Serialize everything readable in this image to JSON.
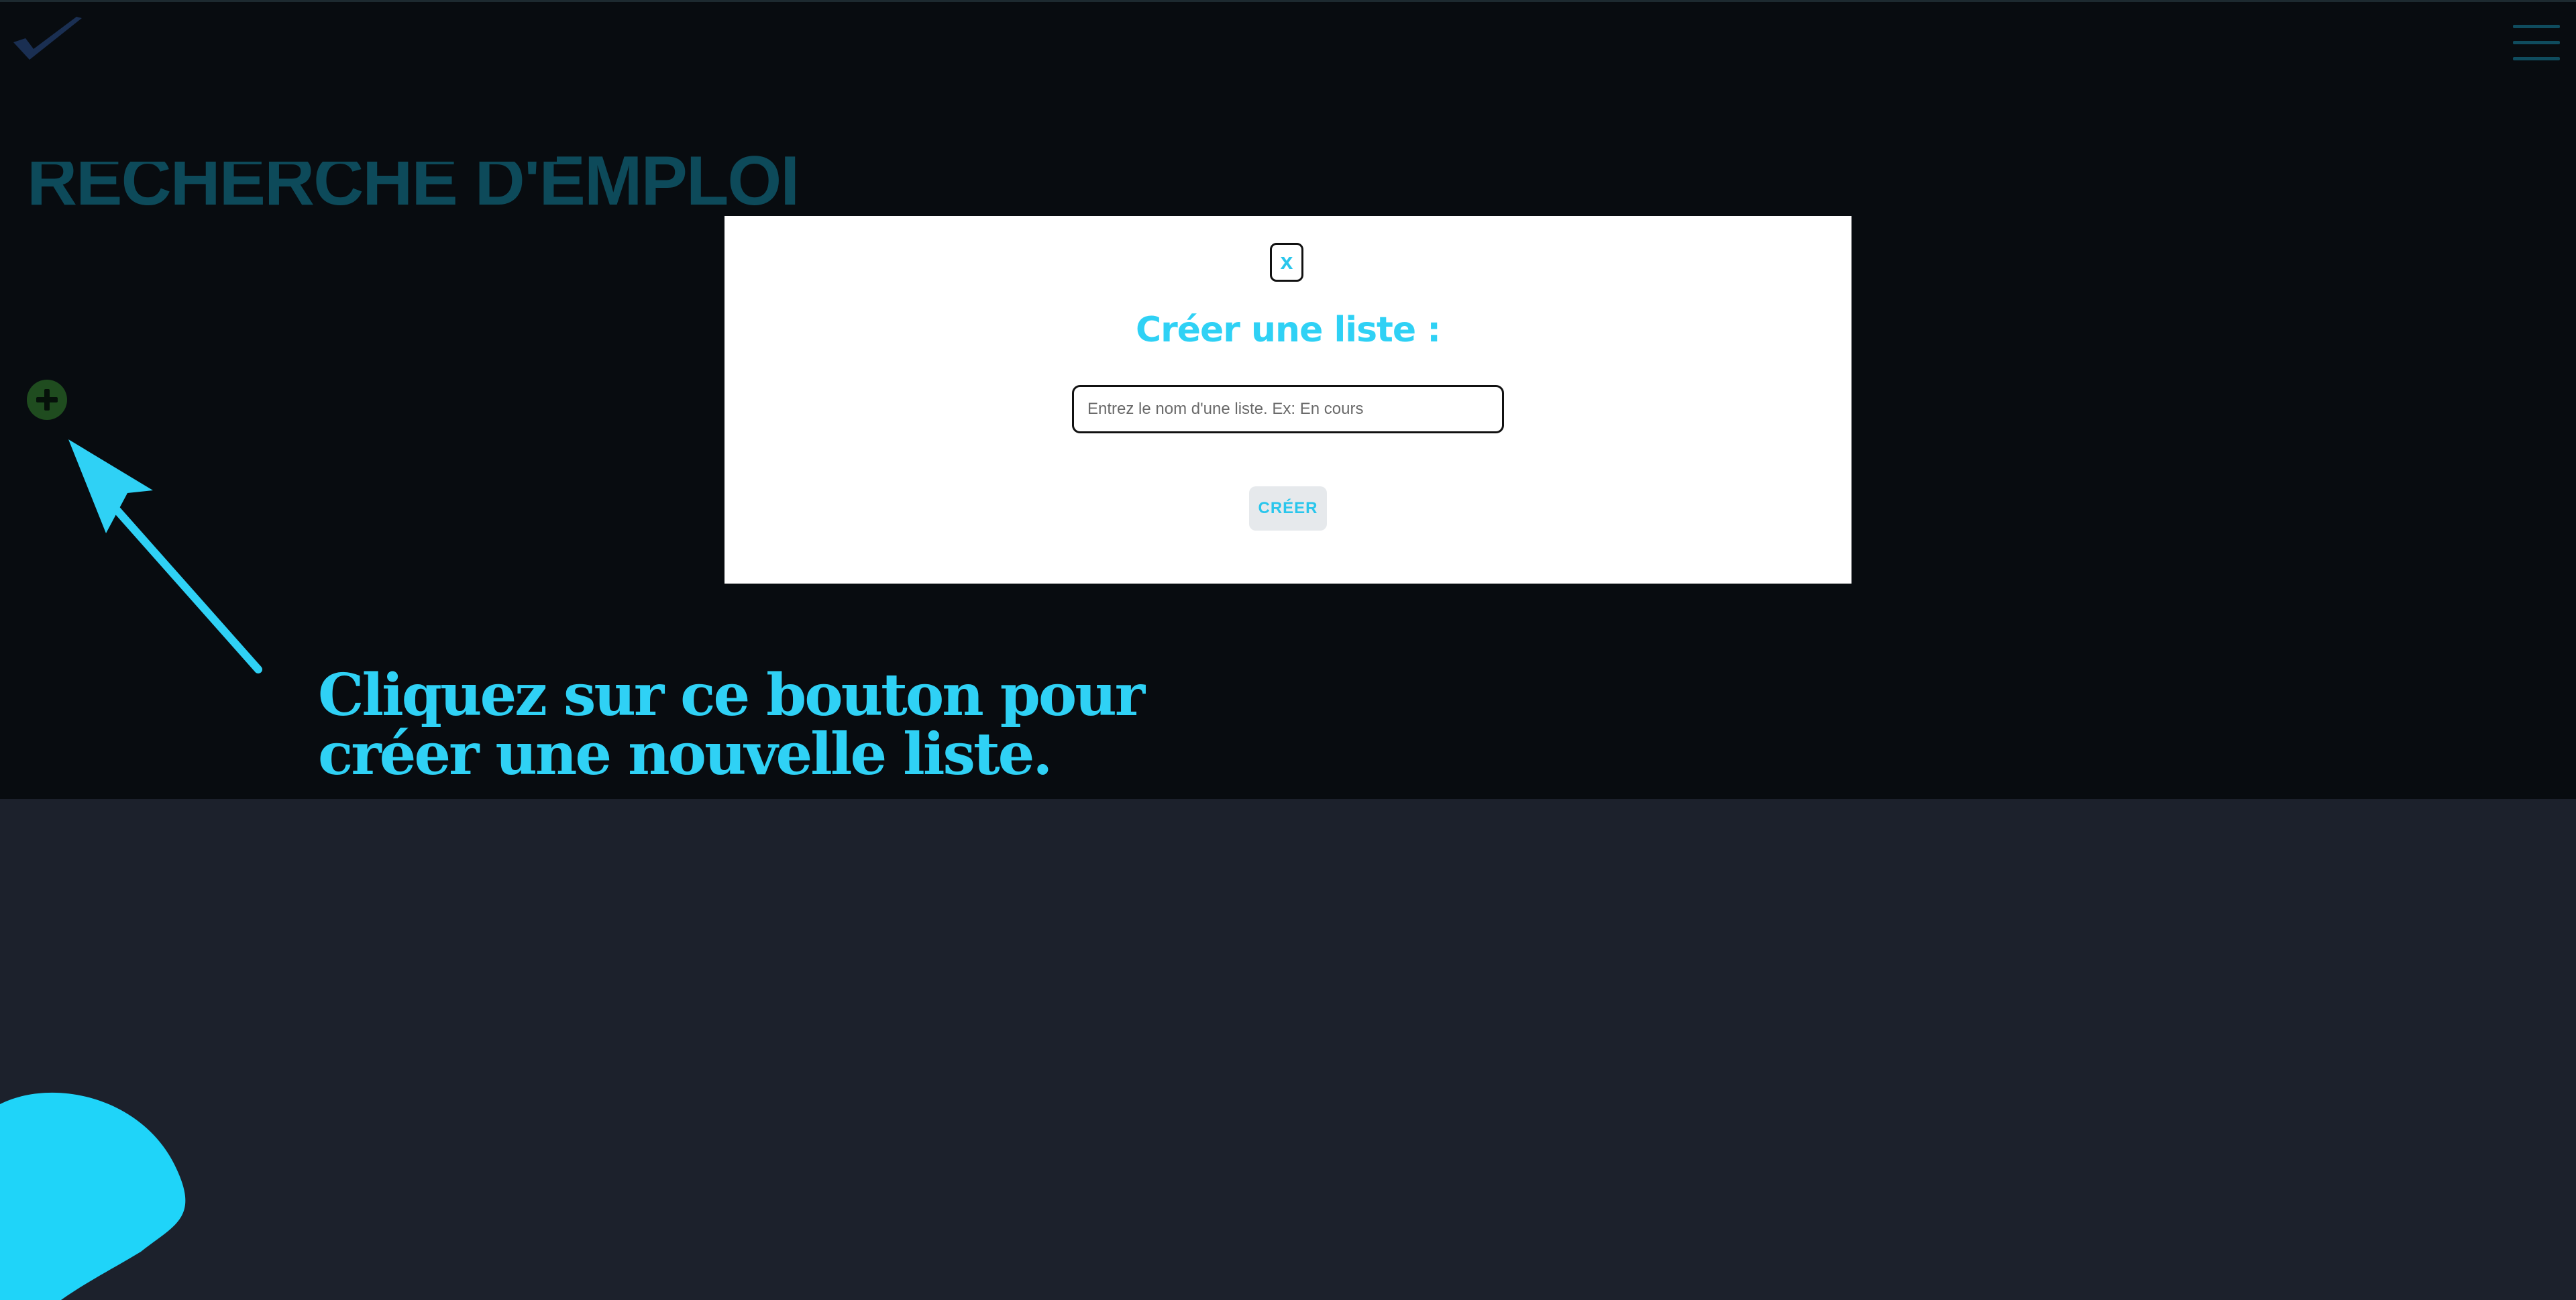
{
  "header": {
    "logo_icon": "checkmark-logo-icon",
    "menu_icon": "hamburger-menu-icon",
    "page_title": "RECHERCHE D'EMPLOI"
  },
  "board": {
    "add_list_icon": "plus-circle-icon"
  },
  "onboarding": {
    "hint_line_1": "Cliquez sur ce bouton pour",
    "hint_line_2": "créer une nouvelle liste.",
    "arrow_icon": "arrow-pointer-icon"
  },
  "modal": {
    "close_label": "x",
    "title": "Créer une liste :",
    "input_placeholder": "Entrez le nom d'une liste. Ex: En cours",
    "input_value": "",
    "create_label": "CRÉER"
  },
  "colors": {
    "accent": "#2fd1f5",
    "top_background": "#080c10",
    "bottom_background": "#1c212c",
    "title_color": "#0d4a5a",
    "add_button": "#1f4c1f"
  }
}
